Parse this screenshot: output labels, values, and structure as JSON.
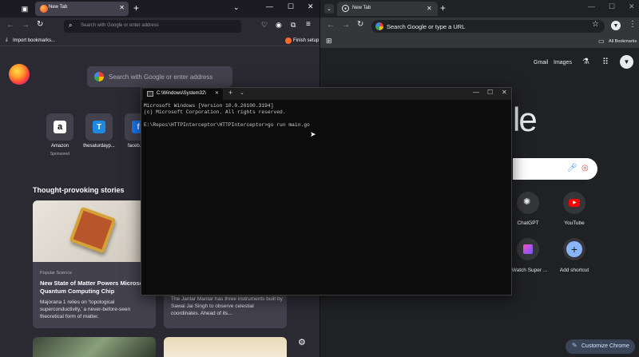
{
  "firefox": {
    "tab_title": "New Tab",
    "url_placeholder": "Search with Google or enter address",
    "bookmarks": {
      "import_label": "Import bookmarks...",
      "finish_setup": "Finish setup"
    },
    "search_placeholder": "Search with Google or enter address",
    "shortcuts": [
      {
        "label": "Amazon",
        "sub": "Sponsored",
        "color": "#ffffff",
        "letter": "a"
      },
      {
        "label": "thesaturdayp...",
        "sub": "",
        "color": "#1e88e5",
        "letter": ""
      },
      {
        "label": "faceb...",
        "sub": "",
        "color": "#1877f2",
        "letter": ""
      }
    ],
    "stories_heading": "Thought-provoking stories",
    "stories": [
      {
        "source": "Popular Science",
        "title": "New State of Matter Powers Microsoft Quantum Computing Chip",
        "excerpt": "Majorana 1 relies on ‘topological superconductivity,’ a never-before-seen theoretical form of matter."
      },
      {
        "source": "",
        "title": "",
        "excerpt": "The Jantar Mantar has three instruments built by Sawai Jai Singh to observe celestial coordinates. Ahead of its..."
      }
    ]
  },
  "chrome": {
    "tab_title": "New Tab",
    "omnibox_placeholder": "Search Google or type a URL",
    "all_bookmarks": "All Bookmarks",
    "header_links": {
      "gmail": "Gmail",
      "images": "Images"
    },
    "logo_partial": "le",
    "shortcuts": [
      {
        "label": "ChatGPT"
      },
      {
        "label": "YouTube"
      },
      {
        "label": "Watch Super ..."
      },
      {
        "label": "Add shortcut"
      }
    ],
    "customize_label": "Customize Chrome"
  },
  "terminal": {
    "tab_title": "C:\\Windows\\System32\\",
    "lines": [
      "Microsoft Windows [Version 10.0.26100.3194]",
      "(c) Microsoft Corporation. All rights reserved.",
      "",
      "E:\\Repos\\HTTPInterceptor\\HTTPInterceptor>go run main.go"
    ]
  },
  "colors": {
    "firefox_bg": "#2b2a33",
    "chrome_bg": "#202124",
    "terminal_bg": "#0c0c0c",
    "chrome_accent": "#8ab4f8",
    "youtube_red": "#ff0000"
  }
}
